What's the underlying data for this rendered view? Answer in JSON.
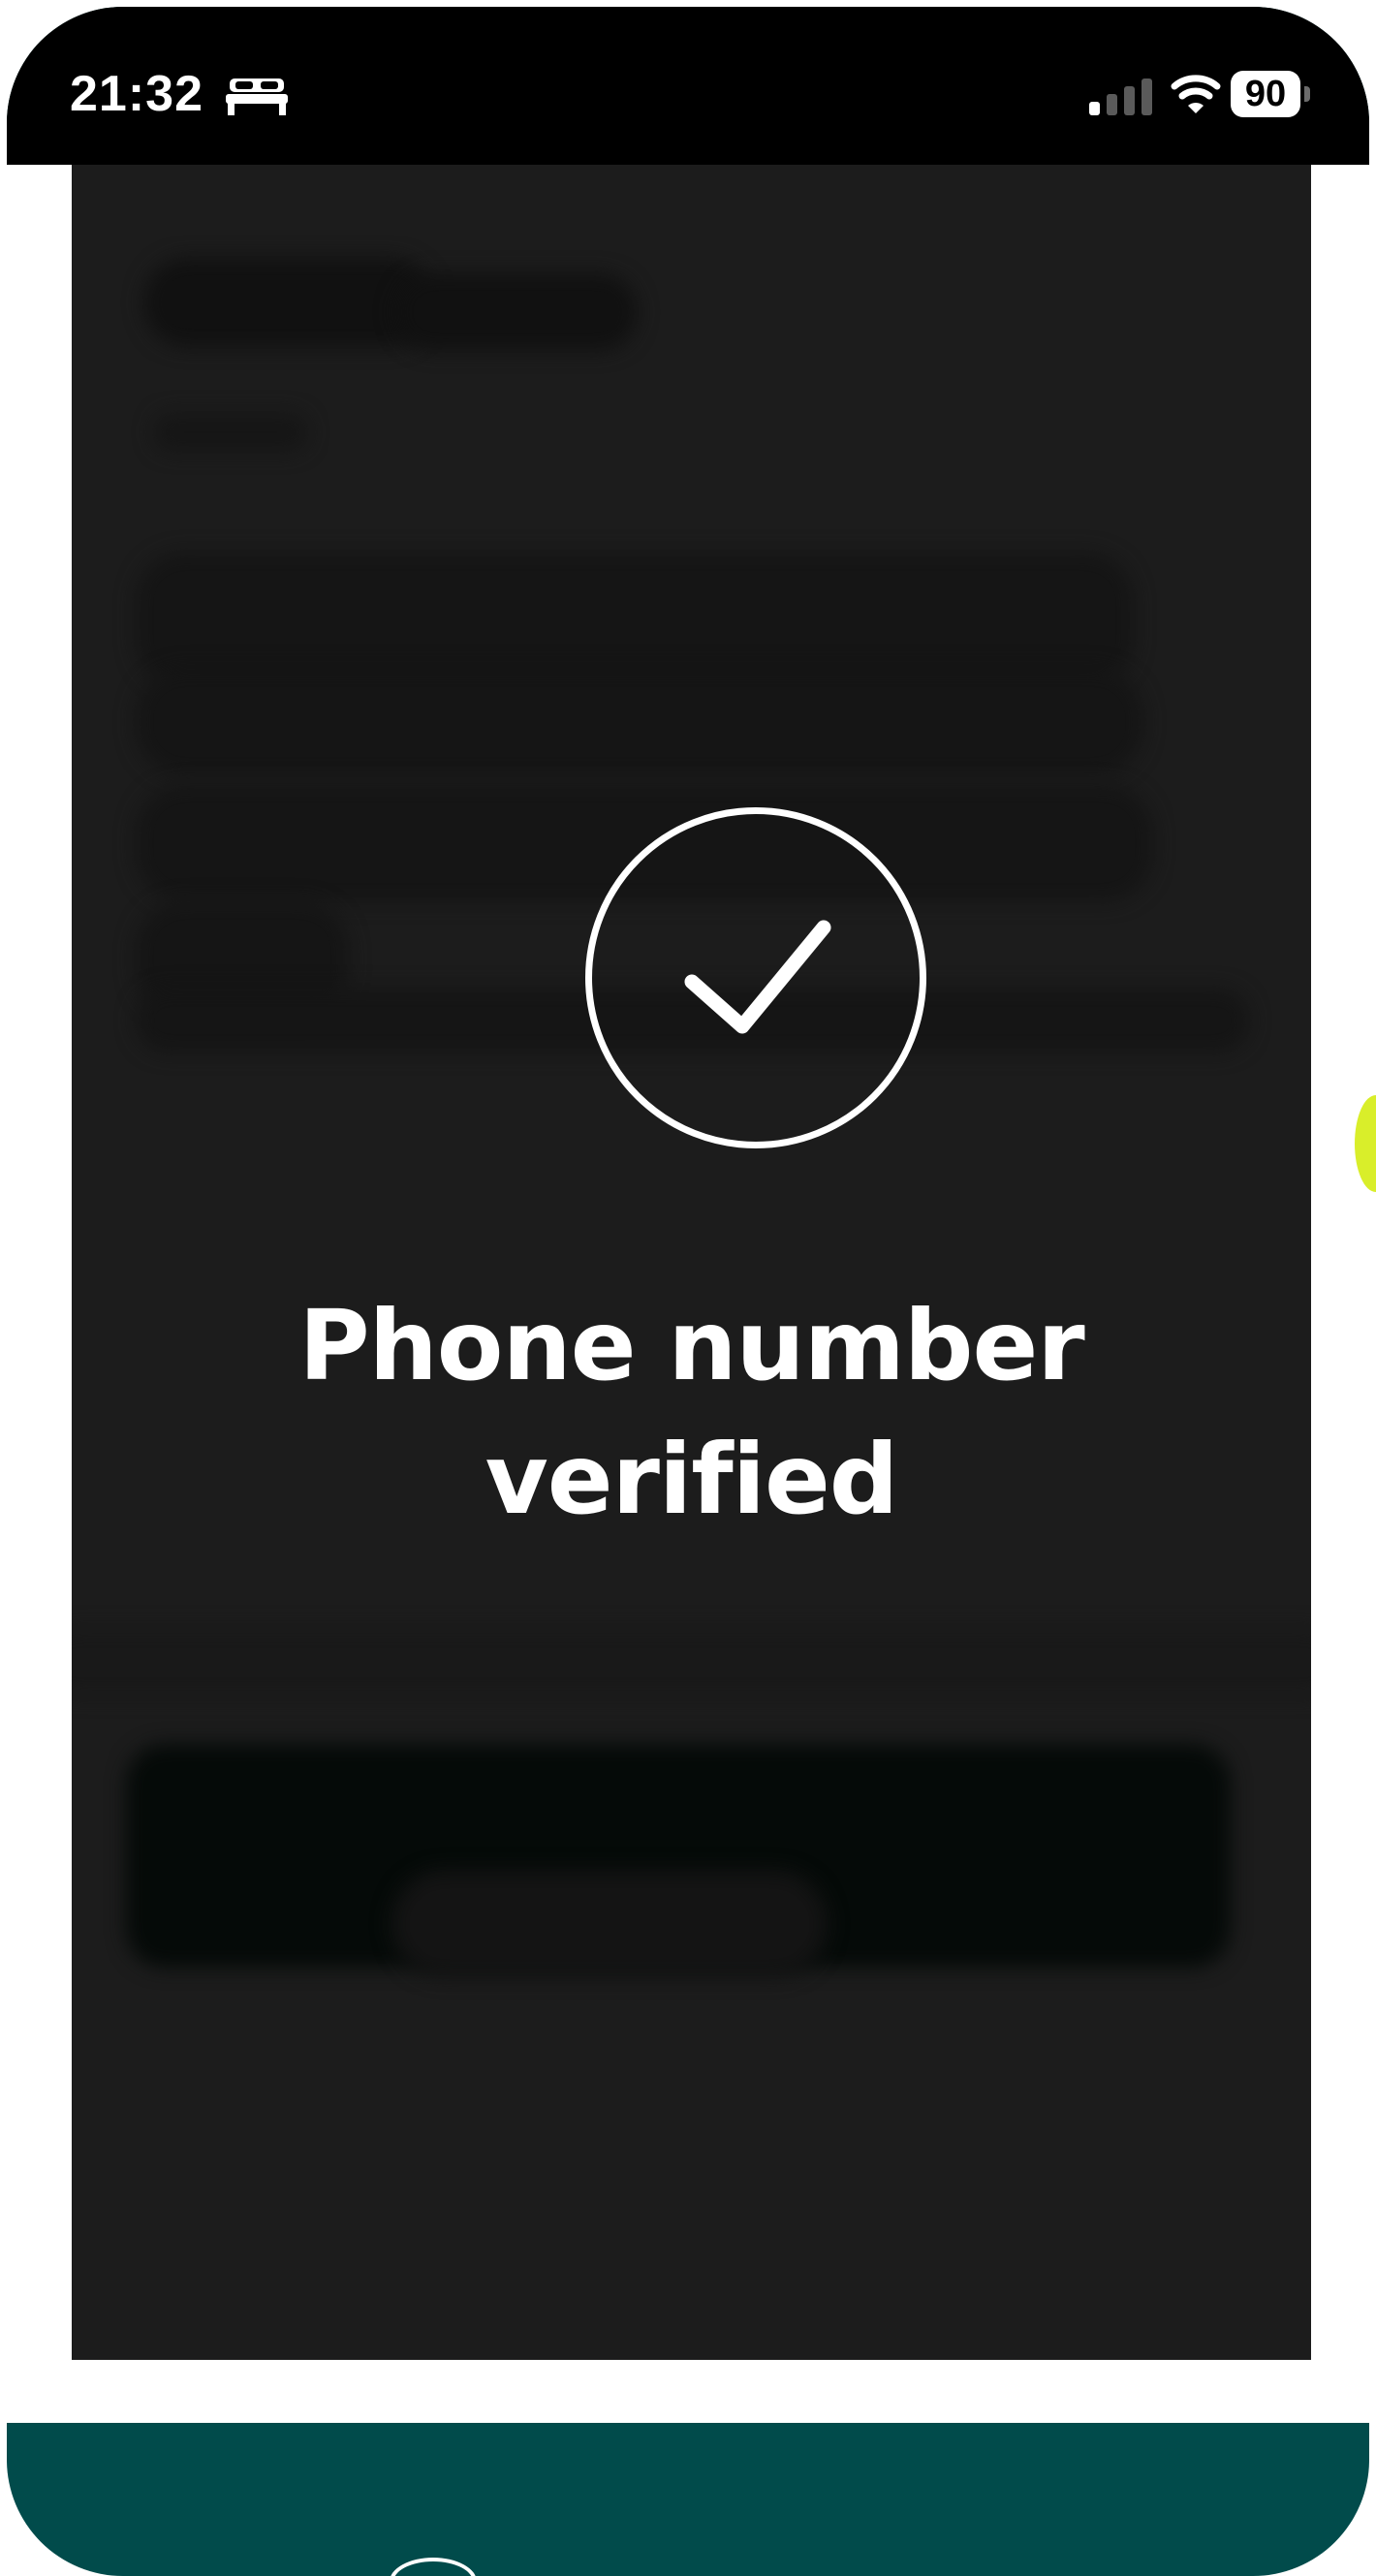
{
  "status_bar": {
    "time": "21:32",
    "focus_icon": "bed-icon",
    "signal_icon": "cellular-signal-icon",
    "wifi_icon": "wifi-icon",
    "battery_level": "90"
  },
  "overlay": {
    "icon": "check-circle-icon",
    "title": "Phone number\nverified"
  },
  "colors": {
    "frame": "#014b4b",
    "overlay_background": "#1c1c1c",
    "status_bar": "#000000",
    "edge_indicator": "#d9ee2a"
  }
}
